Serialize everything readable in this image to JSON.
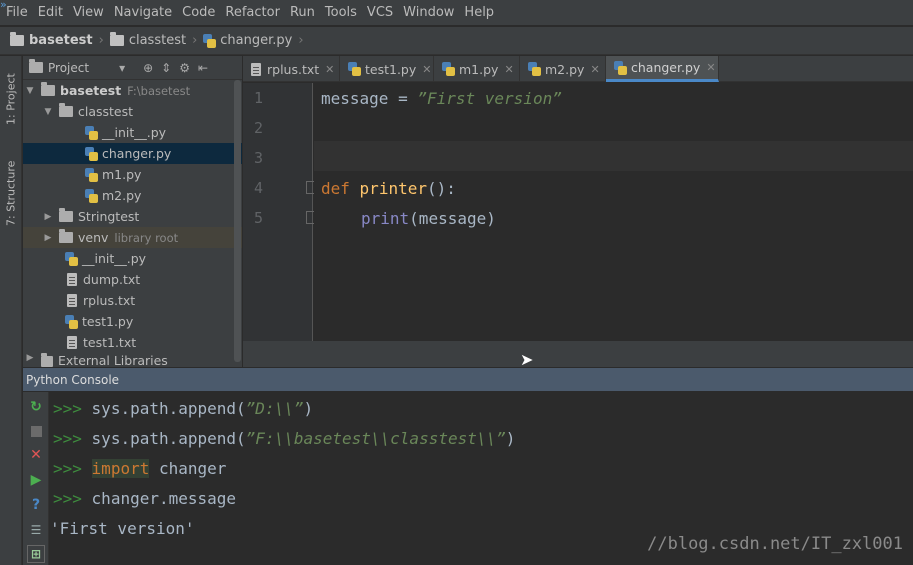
{
  "menu": [
    "File",
    "Edit",
    "View",
    "Navigate",
    "Code",
    "Refactor",
    "Run",
    "Tools",
    "VCS",
    "Window",
    "Help"
  ],
  "menu_edge_icon": "double-chevron-icon",
  "breadcrumb": [
    "basetest",
    "classtest",
    "changer.py"
  ],
  "left_strip": {
    "project_tab": "1: Project",
    "structure_tab": "7: Structure"
  },
  "project": {
    "header": "Project",
    "tree": [
      {
        "label": "basetest",
        "hint": "F:\\basetest"
      },
      {
        "label": "classtest"
      },
      {
        "label": "__init__.py"
      },
      {
        "label": "changer.py"
      },
      {
        "label": "m1.py"
      },
      {
        "label": "m2.py"
      },
      {
        "label": "Stringtest"
      },
      {
        "label": "venv",
        "hint": "library root"
      },
      {
        "label": "__init__.py"
      },
      {
        "label": "dump.txt"
      },
      {
        "label": "rplus.txt"
      },
      {
        "label": "test1.py"
      },
      {
        "label": "test1.txt"
      },
      {
        "label": "External Libraries"
      }
    ]
  },
  "tabs": [
    "rplus.txt",
    "test1.py",
    "m1.py",
    "m2.py",
    "changer.py"
  ],
  "active_tab": "changer.py",
  "editor": {
    "line_numbers": [
      "1",
      "2",
      "3",
      "4",
      "5"
    ],
    "line1": {
      "var": "message",
      "op": " = ",
      "str": "”First version”"
    },
    "line4": {
      "kw": "def",
      "fn": "printer",
      "rest": "():"
    },
    "line5": {
      "bi": "print",
      "rest": "(message)"
    }
  },
  "console": {
    "title": "Python Console",
    "prompt": ">>>",
    "lines": [
      {
        "pre": "sys.path.append(",
        "str": "”D:\\\\”",
        "post": ")"
      },
      {
        "pre": "sys.path.append(",
        "str": "”F:\\\\basetest\\\\classtest\\\\”",
        "post": ")"
      },
      {
        "kw": "import",
        "post": " changer"
      },
      {
        "pre": "changer.message"
      }
    ],
    "output": "'First version'"
  },
  "watermark": "//blog.csdn.net/IT_zxl001",
  "colors": {
    "keyword": "#cc7832",
    "function": "#ffc66d",
    "string": "#6a8759",
    "builtin": "#8888c6",
    "selection": "#0d293e",
    "active_tab_underline": "#4a88c7"
  }
}
